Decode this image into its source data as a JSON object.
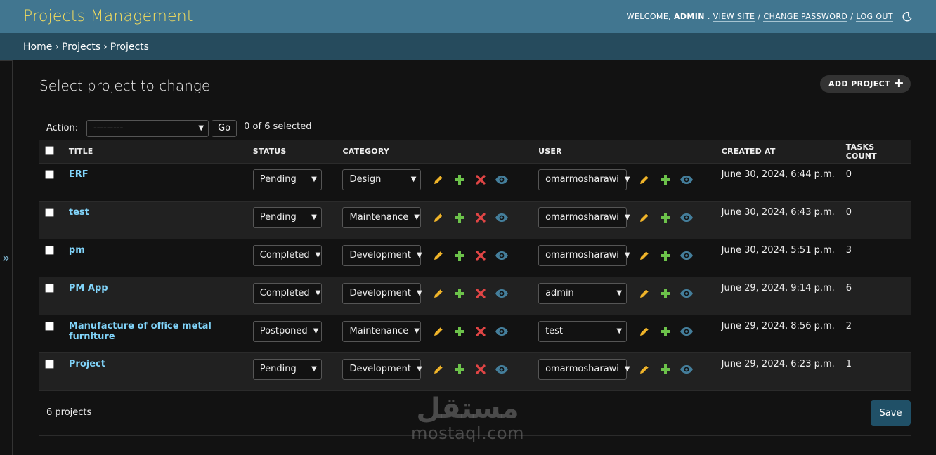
{
  "header": {
    "brand": "Projects Management",
    "welcome": "WELCOME,",
    "username": "ADMIN",
    "view_site": "VIEW SITE",
    "change_password": "CHANGE PASSWORD",
    "log_out": "LOG OUT",
    "theme_icon": "moon-icon"
  },
  "breadcrumbs": [
    "Home",
    "Projects",
    "Projects"
  ],
  "sidebar": {
    "toggle_glyph": "»"
  },
  "page": {
    "title": "Select project to change",
    "add_label": "ADD PROJECT"
  },
  "actions": {
    "label": "Action:",
    "selected": "---------",
    "go": "Go",
    "selection_count": "0 of 6 selected"
  },
  "columns": [
    "TITLE",
    "STATUS",
    "CATEGORY",
    "USER",
    "CREATED AT",
    "TASKS COUNT"
  ],
  "rows": [
    {
      "title": "ERF",
      "status": "Pending",
      "category": "Design",
      "user": "omarmosharawi",
      "created_at": "June 30, 2024, 6:44 p.m.",
      "tasks": "0"
    },
    {
      "title": "test",
      "status": "Pending",
      "category": "Maintenance",
      "user": "omarmosharawi",
      "created_at": "June 30, 2024, 6:43 p.m.",
      "tasks": "0"
    },
    {
      "title": "pm",
      "status": "Completed",
      "category": "Development",
      "user": "omarmosharawi",
      "created_at": "June 30, 2024, 5:51 p.m.",
      "tasks": "3"
    },
    {
      "title": "PM App",
      "status": "Completed",
      "category": "Development",
      "user": "admin",
      "created_at": "June 29, 2024, 9:14 p.m.",
      "tasks": "6"
    },
    {
      "title": "Manufacture of office metal furniture",
      "status": "Postponed",
      "category": "Maintenance",
      "user": "test",
      "created_at": "June 29, 2024, 8:56 p.m.",
      "tasks": "2"
    },
    {
      "title": "Project",
      "status": "Pending",
      "category": "Development",
      "user": "omarmosharawi",
      "created_at": "June 29, 2024, 6:23 p.m.",
      "tasks": "1"
    }
  ],
  "footer": {
    "count": "6 projects",
    "save": "Save"
  },
  "watermark": {
    "arabic": "مستقل",
    "latin": "mostaql.com"
  },
  "colors": {
    "header_bg": "#417690",
    "breadcrumb_bg": "#264b5d",
    "brand": "#f5dd5d",
    "link": "#81d4fa",
    "edit_icon": "#f0b429",
    "add_icon": "#6cc24a",
    "delete_icon": "#e04545",
    "view_icon": "#447e9b"
  }
}
